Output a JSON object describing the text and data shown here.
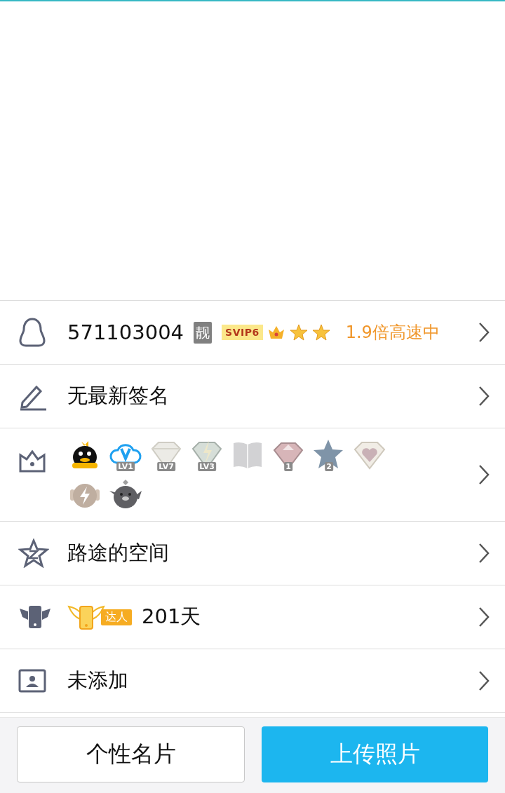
{
  "account": {
    "number": "571103004",
    "tag": "靓",
    "vip": "SVIP6",
    "speed": "1.9倍高速中"
  },
  "rows": [
    {
      "kind": "signature",
      "text": "无最新签名"
    },
    {
      "kind": "badges",
      "badges": [
        {
          "kind": "penguin"
        },
        {
          "kind": "cloud",
          "label": "LV1"
        },
        {
          "kind": "diamond",
          "label": "LV7"
        },
        {
          "kind": "bolt-diamond",
          "label": "LV3"
        },
        {
          "kind": "book"
        },
        {
          "kind": "gem",
          "label": "1"
        },
        {
          "kind": "star",
          "label": "2"
        },
        {
          "kind": "heart-gem"
        },
        {
          "kind": "speed"
        },
        {
          "kind": "bird"
        }
      ]
    },
    {
      "kind": "space",
      "text": "路途的空间"
    },
    {
      "kind": "mobile",
      "badge": "达人",
      "text": "201天"
    },
    {
      "kind": "card",
      "text": "未添加"
    }
  ],
  "buttons": [
    {
      "label": "个性名片",
      "primary": false
    },
    {
      "label": "上传照片",
      "primary": true
    }
  ]
}
